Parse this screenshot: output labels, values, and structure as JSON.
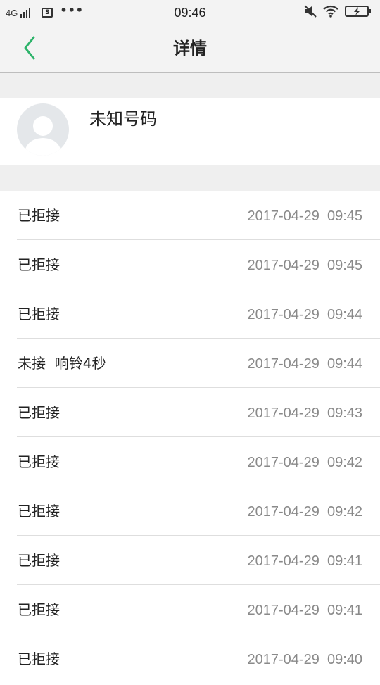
{
  "status_bar": {
    "network": "4G",
    "time": "09:46",
    "sim_label": "S",
    "more_dots": "•••"
  },
  "header": {
    "title": "详情"
  },
  "contact": {
    "name": "未知号码"
  },
  "calls": [
    {
      "status": "已拒接",
      "datetime": "2017-04-29  09:45"
    },
    {
      "status": "已拒接",
      "datetime": "2017-04-29  09:45"
    },
    {
      "status": "已拒接",
      "datetime": "2017-04-29  09:44"
    },
    {
      "status": "未接  响铃4秒",
      "datetime": "2017-04-29  09:44"
    },
    {
      "status": "已拒接",
      "datetime": "2017-04-29  09:43"
    },
    {
      "status": "已拒接",
      "datetime": "2017-04-29  09:42"
    },
    {
      "status": "已拒接",
      "datetime": "2017-04-29  09:42"
    },
    {
      "status": "已拒接",
      "datetime": "2017-04-29  09:41"
    },
    {
      "status": "已拒接",
      "datetime": "2017-04-29  09:41"
    },
    {
      "status": "已拒接",
      "datetime": "2017-04-29  09:40"
    }
  ],
  "colors": {
    "accent": "#2db36a",
    "bar_background": "#f3f3f3",
    "section_gap": "#efefef",
    "secondary_text": "#8a8a8a"
  }
}
